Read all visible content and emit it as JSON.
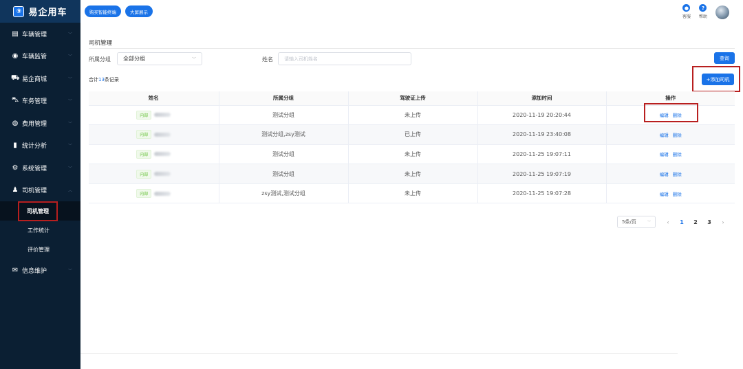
{
  "app": {
    "logo_glyph": "⑨",
    "name": "易企用车"
  },
  "header": {
    "buttons": [
      {
        "label": "购买智能终端"
      },
      {
        "label": "大屏展示"
      }
    ],
    "service": {
      "label": "客服",
      "icon": "headset-icon"
    },
    "help": {
      "label": "帮助",
      "icon": "help-icon",
      "glyph": "?"
    }
  },
  "sidebar": {
    "items": [
      {
        "label": "车辆管理",
        "icon": "vehicle-doc-icon",
        "glyph": "▤"
      },
      {
        "label": "车辆监管",
        "icon": "location-icon",
        "glyph": "◉"
      },
      {
        "label": "易企商城",
        "icon": "cart-icon",
        "glyph": "⛟"
      },
      {
        "label": "车务管理",
        "icon": "car-icon",
        "glyph": "⛍"
      },
      {
        "label": "费用管理",
        "icon": "money-icon",
        "glyph": "◍"
      },
      {
        "label": "统计分析",
        "icon": "bar-chart-icon",
        "glyph": "▮"
      },
      {
        "label": "系统管理",
        "icon": "gear-icon",
        "glyph": "⚙"
      },
      {
        "label": "司机管理",
        "icon": "user-icon",
        "glyph": "♟"
      },
      {
        "label": "信息维护",
        "icon": "mail-icon",
        "glyph": "✉"
      }
    ],
    "sub_items": [
      {
        "label": "司机管理"
      },
      {
        "label": "工作统计"
      },
      {
        "label": "评价管理"
      }
    ]
  },
  "main": {
    "title": "司机管理",
    "filters": {
      "group_label": "所属分组",
      "group_value": "全部分组",
      "name_label": "姓名",
      "name_placeholder": "请输入司机姓名"
    },
    "query_label": "查询",
    "total_prefix": "合计",
    "total_count": "13",
    "total_suffix": "条记录",
    "add_label": "+添加司机",
    "table": {
      "columns": [
        "姓名",
        "所属分组",
        "驾驶证上传",
        "添加时间",
        "操作"
      ],
      "rows": [
        {
          "tag": "内部",
          "group": "测试分组",
          "license": "未上传",
          "time": "2020-11-19 20:20:44"
        },
        {
          "tag": "内部",
          "group": "测试分组,zsy测试",
          "license": "已上传",
          "time": "2020-11-19 23:40:08"
        },
        {
          "tag": "内部",
          "group": "测试分组",
          "license": "未上传",
          "time": "2020-11-25 19:07:11"
        },
        {
          "tag": "内部",
          "group": "测试分组",
          "license": "未上传",
          "time": "2020-11-25 19:07:19"
        },
        {
          "tag": "内部",
          "group": "zsy测试,测试分组",
          "license": "未上传",
          "time": "2020-11-25 19:07:28"
        }
      ],
      "edit_label": "编辑",
      "delete_label": "删除"
    },
    "pagination": {
      "page_size": "5条/页",
      "pages": [
        "1",
        "2",
        "3"
      ],
      "current": "1"
    }
  },
  "colors": {
    "primary": "#1a73e8",
    "sidebar": "#0b1f33",
    "highlight": "#b81f1f"
  }
}
